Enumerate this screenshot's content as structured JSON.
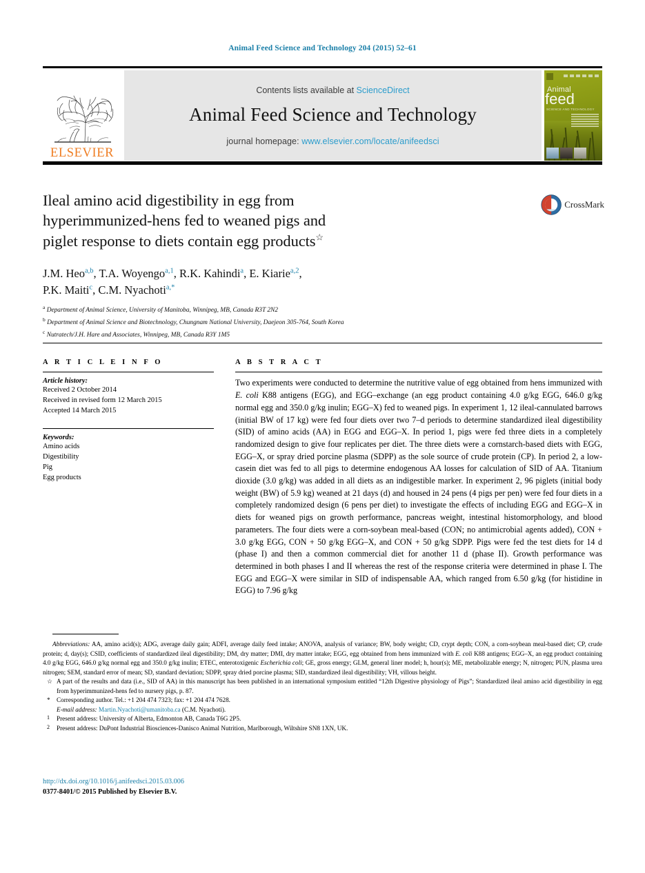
{
  "running_head": "Animal Feed Science and Technology 204 (2015) 52–61",
  "masthead": {
    "publisher_name": "ELSEVIER",
    "contents_prefix": "Contents lists available at",
    "contents_link": "ScienceDirect",
    "journal_title": "Animal Feed Science and Technology",
    "homepage_prefix": "journal homepage:",
    "homepage_url": "www.elsevier.com/locate/anifeedsci",
    "cover": {
      "word_top": "Animal",
      "word_main": "feed",
      "word_sub": "SCIENCE AND TECHNOLOGY"
    }
  },
  "crossmark": {
    "label": "CrossMark"
  },
  "title": {
    "line1": "Ileal amino acid digestibility in egg from",
    "line2": "hyperimmunized-hens fed to weaned pigs and",
    "line3": "piglet response to diets contain egg products",
    "footnote_mark": "☆"
  },
  "authors": {
    "line1": [
      {
        "name": "J.M. Heo",
        "sup": "a,b",
        "sep": ", "
      },
      {
        "name": "T.A. Woyengo",
        "sup": "a,1",
        "sep": ", "
      },
      {
        "name": "R.K. Kahindi",
        "sup": "a",
        "sep": ", "
      },
      {
        "name": "E. Kiarie",
        "sup": "a,2",
        "sep": ","
      }
    ],
    "line2": [
      {
        "name": "P.K. Maiti",
        "sup": "c",
        "sep": ", "
      },
      {
        "name": "C.M. Nyachoti",
        "sup": "a,*",
        "sep": ""
      }
    ]
  },
  "affiliations": [
    {
      "mark": "a",
      "text": "Department of Animal Science, University of Manitoba, Winnipeg, MB, Canada R3T 2N2"
    },
    {
      "mark": "b",
      "text": "Department of Animal Science and Biotechnology, Chungnam National University, Daejeon 305-764, South Korea"
    },
    {
      "mark": "c",
      "text": "Nutratech/J.H. Hare and Associates, Winnipeg, MB, Canada R3Y 1M5"
    }
  ],
  "article_info": {
    "heading": "A R T I C L E   I N F O",
    "history_label": "Article history:",
    "history": [
      "Received 2 October 2014",
      "Received in revised form 12 March 2015",
      "Accepted 14 March 2015"
    ],
    "keywords_label": "Keywords:",
    "keywords": [
      "Amino acids",
      "Digestibility",
      "Pig",
      "Egg products"
    ]
  },
  "abstract": {
    "heading": "A B S T R A C T",
    "paragraphs": [
      "Two experiments were conducted to determine the nutritive value of egg obtained from hens immunized with <i>E. coli</i> K88 antigens (EGG), and EGG–exchange (an egg product containing 4.0 g/kg EGG, 646.0 g/kg normal egg and 350.0 g/kg inulin; EGG–X) fed to weaned pigs. In experiment 1, 12 ileal-cannulated barrows (initial BW of 17 kg) were fed four diets over two 7–d periods to determine standardized ileal digestibility (SID) of amino acids (AA) in EGG and EGG–X. In period 1, pigs were fed three diets in a completely randomized design to give four replicates per diet. The three diets were a cornstarch-based diets with EGG, EGG–X, or spray dried porcine plasma (SDPP) as the sole source of crude protein (CP). In period 2, a low-casein diet was fed to all pigs to determine endogenous AA losses for calculation of SID of AA. Titanium dioxide (3.0 g/kg) was added in all diets as an indigestible marker. In experiment 2, 96 piglets (initial body weight (BW) of 5.9 kg) weaned at 21 days (d) and housed in 24 pens (4 pigs per pen) were fed four diets in a completely randomized design (6 pens per diet) to investigate the effects of including EGG and EGG–X in diets for weaned pigs on growth performance, pancreas weight, intestinal histomorphology, and blood parameters. The four diets were a corn-soybean meal-based (CON; no antimicrobial agents added), CON + 3.0 g/kg EGG, CON + 50 g/kg EGG–X, and CON + 50 g/kg SDPP. Pigs were fed the test diets for 14 d (phase I) and then a common commercial diet for another 11 d (phase II). Growth performance was determined in both phases I and II whereas the rest of the response criteria were determined in phase I. The EGG and EGG–X were similar in SID of indispensable AA, which ranged from 6.50 g/kg (for histidine in EGG) to 7.96 g/kg"
    ]
  },
  "footnotes": {
    "abbreviations_label": "Abbreviations:",
    "abbreviations_text": "AA, amino acid(s); ADG, average daily gain; ADFI, average daily feed intake; ANOVA, analysis of variance; BW, body weight; CD, crypt depth; CON, a corn-soybean meal-based diet; CP, crude protein; d, day(s); CSID, coefficients of standardized ileal digestibility; DM, dry matter; DMI, dry matter intake; EGG, egg obtained from hens immunized with <i>E. coli</i> K88 antigens; EGG–X, an egg product containing 4.0 g/kg EGG, 646.0 g/kg normal egg and 350.0 g/kg inulin; ETEC, enterotoxigenic <i>Escherichia coli</i>; GE, gross energy; GLM, general liner model; h, hour(s); ME, metabolizable energy; N, nitrogen; PUN, plasma urea nitrogen; SEM, standard error of mean; SD, standard deviation; SDPP, spray dried porcine plasma; SID, standardized ileal digestibility; VH, villous height.",
    "star_mark": "☆",
    "star_text": "A part of the results and data (i.e., SID of AA) in this manuscript has been published in an international symposium entitled “12th Digestive physiology of Pigs”; Standardized ileal amino acid digestibility in egg from hyperimmunized-hens fed to nursery pigs, p. 87.",
    "corr_mark": "*",
    "corr_text": "Corresponding author. Tel.: +1 204 474 7323; fax: +1 204 474 7628.",
    "email_label": "E-mail address:",
    "email_address": "Martin.Nyachoti@umanitoba.ca",
    "email_suffix": "(C.M. Nyachoti).",
    "present_addresses": [
      {
        "mark": "1",
        "text": "Present address: University of Alberta, Edmonton AB, Canada T6G 2P5."
      },
      {
        "mark": "2",
        "text": "Present address: DuPont Industrial Biosciences-Danisco Animal Nutrition, Marlborough, Wiltshire SN8 1XN, UK."
      }
    ]
  },
  "footer": {
    "doi": "http://dx.doi.org/10.1016/j.anifeedsci.2015.03.006",
    "copyright": "0377-8401/© 2015 Published by Elsevier B.V."
  },
  "colors": {
    "link_blue": "#1a7fa8",
    "sciencedirect_blue": "#2b9ccc",
    "elsevier_orange": "#ef7d22",
    "masthead_grey": "#e6e6e6"
  }
}
